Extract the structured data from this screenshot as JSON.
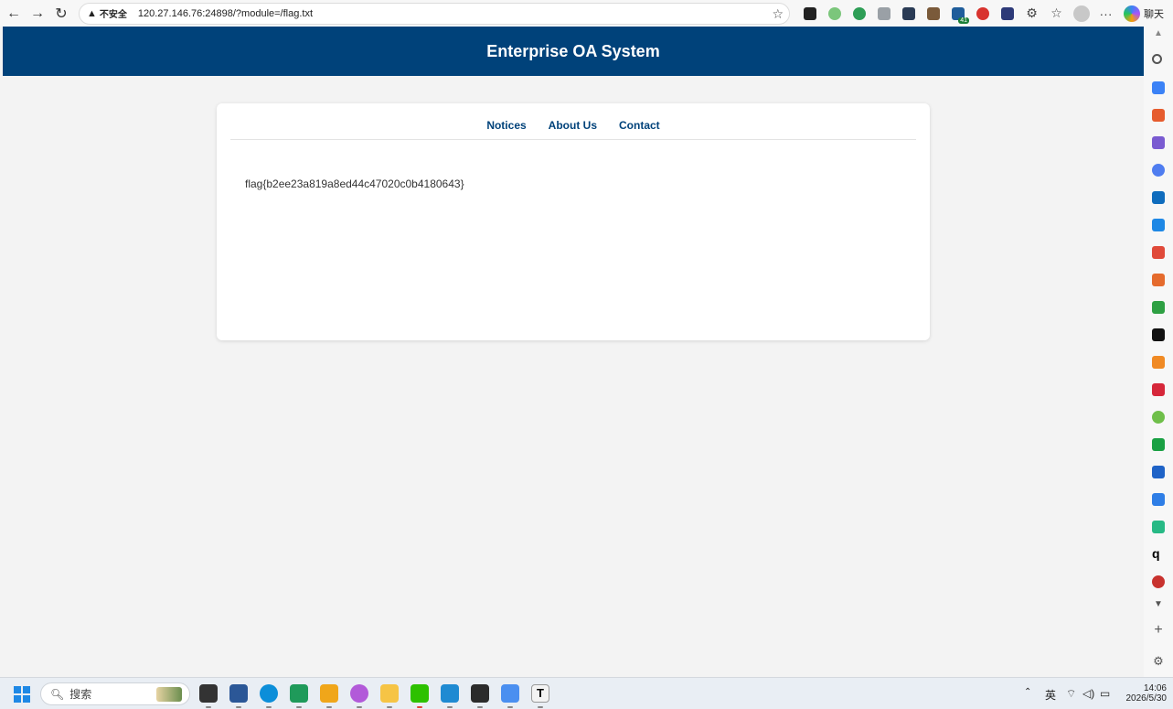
{
  "browser": {
    "security_warning": "不安全",
    "url": "120.27.146.76:24898/?module=/flag.txt",
    "chat_label": "聊天",
    "more_label": "···"
  },
  "site": {
    "title": "Enterprise OA System",
    "nav": [
      {
        "label": "Notices"
      },
      {
        "label": "About Us"
      },
      {
        "label": "Contact"
      }
    ],
    "content": "flag{b2ee23a819a8ed44c47020c0b4180643}"
  },
  "extensions": [
    {
      "icon": "bookmark-extension-icon",
      "color": "#222222"
    },
    {
      "icon": "ring-extension-icon",
      "color": "#7bc67b"
    },
    {
      "icon": "rss-extension-icon",
      "color": "#2e9e56"
    },
    {
      "icon": "reader-extension-icon",
      "color": "#9aa0a6"
    },
    {
      "icon": "dark-extension-icon",
      "color": "#2a3b55"
    },
    {
      "icon": "image-extension-icon",
      "color": "#7a5a3a"
    },
    {
      "icon": "translate-extension-icon",
      "color": "#1f5d9b"
    },
    {
      "icon": "target-extension-icon",
      "color": "#d8332e"
    },
    {
      "icon": "grid-extension-icon",
      "color": "#2d3a78"
    }
  ],
  "extension_badge": "41",
  "sidebar": [
    {
      "icon": "search-icon",
      "color": "#555555"
    },
    {
      "icon": "tag-icon",
      "color": "#3b82f6"
    },
    {
      "icon": "briefcase-icon",
      "color": "#e65c2e"
    },
    {
      "icon": "chess-icon",
      "color": "#7a5bd1"
    },
    {
      "icon": "copilot-icon",
      "color": "#4f7df0"
    },
    {
      "icon": "outlook-icon",
      "color": "#0f6cbd"
    },
    {
      "icon": "send-icon",
      "color": "#1e88e5"
    },
    {
      "icon": "pdf-icon",
      "color": "#e04a3a"
    },
    {
      "icon": "c-icon",
      "color": "#e56b2d"
    },
    {
      "icon": "bar-icon",
      "color": "#2ea043"
    },
    {
      "icon": "shield-icon",
      "color": "#111111"
    },
    {
      "icon": "box-icon",
      "color": "#f08a24"
    },
    {
      "icon": "grid-red-icon",
      "color": "#d6273a"
    },
    {
      "icon": "circle-green-icon",
      "color": "#6fbf4a"
    },
    {
      "icon": "y-icon",
      "color": "#19a043"
    },
    {
      "icon": "paper-icon",
      "color": "#1f63c7"
    },
    {
      "icon": "cube-icon",
      "color": "#2f7ee6"
    },
    {
      "icon": "c-green-icon",
      "color": "#27b985"
    },
    {
      "icon": "q-icon",
      "color": "#222222"
    },
    {
      "icon": "ball-icon",
      "color": "#c8322e"
    }
  ],
  "taskbar": {
    "search_placeholder": "搜索",
    "apps": [
      {
        "icon": "file-app-icon",
        "color": "#333333"
      },
      {
        "icon": "edit-app-icon",
        "color": "#2b5797"
      },
      {
        "icon": "edge-app-icon",
        "color": "#0c8ed9"
      },
      {
        "icon": "excel-app-icon",
        "color": "#1f9a5a"
      },
      {
        "icon": "box-app-icon",
        "color": "#f0a61a"
      },
      {
        "icon": "cat-app-icon",
        "color": "#b25ad9"
      },
      {
        "icon": "folder-app-icon",
        "color": "#f6c445"
      },
      {
        "icon": "wechat-app-icon",
        "color": "#2dc100"
      },
      {
        "icon": "vscode-app-icon",
        "color": "#1f8ad2"
      },
      {
        "icon": "terminal-app-icon",
        "color": "#2b2b2b"
      },
      {
        "icon": "network-app-icon",
        "color": "#4a8ff0"
      },
      {
        "icon": "typora-app-icon",
        "color": "#f3f3f3"
      }
    ],
    "ime": "英",
    "time": "14:06",
    "date": "2026/5/30"
  }
}
